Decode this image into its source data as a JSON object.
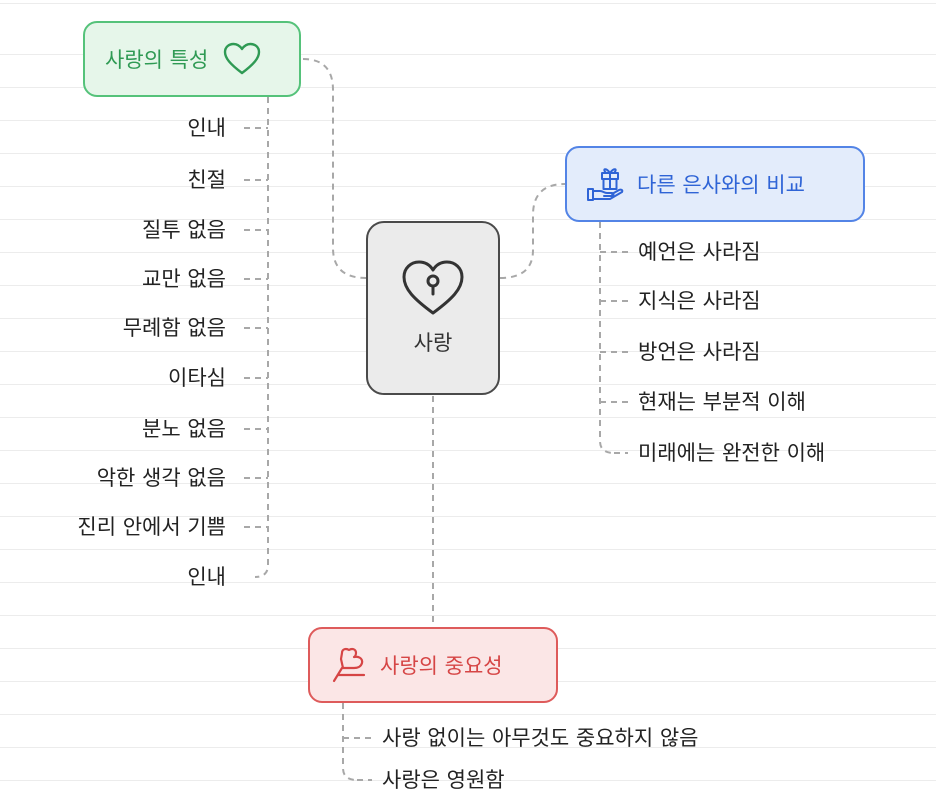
{
  "center": {
    "label": "사랑",
    "icon": "heart-lock-icon"
  },
  "traits": {
    "title": "사랑의 특성",
    "icon": "heart-icon",
    "color": "#55c27a",
    "items": [
      "인내",
      "친절",
      "질투 없음",
      "교만 없음",
      "무례함 없음",
      "이타심",
      "분노 없음",
      "악한 생각 없음",
      "진리 안에서 기쁨",
      "인내"
    ]
  },
  "comparison": {
    "title": "다른 은사와의 비교",
    "icon": "gift-hand-icon",
    "color": "#5384e6",
    "items": [
      "예언은 사라짐",
      "지식은 사라짐",
      "방언은 사라짐",
      "현재는 부분적 이해",
      "미래에는 완전한 이해"
    ]
  },
  "importance": {
    "title": "사랑의 중요성",
    "icon": "heart-signpost-icon",
    "color": "#de5b5b",
    "items": [
      "사랑 없이는 아무것도 중요하지 않음",
      "사랑은 영원함"
    ]
  }
}
